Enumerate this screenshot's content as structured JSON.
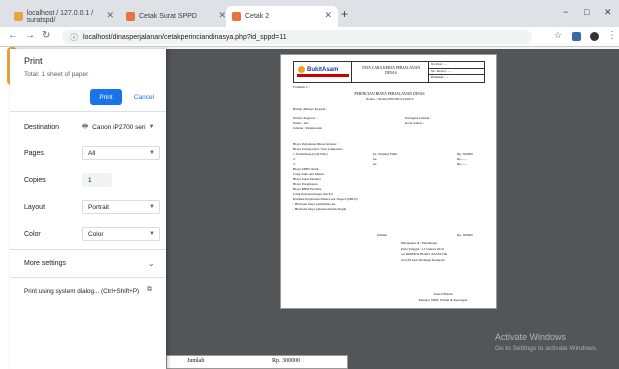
{
  "tabs": [
    {
      "title": "localhost / 127.0.0.1 / suratspd/"
    },
    {
      "title": "Cetak Surat SPPD"
    },
    {
      "title": "Cetak 2"
    }
  ],
  "new_tab": "+",
  "window_controls": [
    "−",
    "□",
    "✕"
  ],
  "url": "localhost/dinasperjalanan/cetakperinciandinasya.php?id_sppd=11",
  "print": {
    "title": "Print",
    "total": "Total: 1 sheet of paper",
    "print_button": "Print",
    "cancel_button": "Cancel",
    "destination_label": "Destination",
    "destination_value": "Canon iP2700 seri",
    "pages_label": "Pages",
    "pages_value": "All",
    "copies_label": "Copies",
    "copies_value": "1",
    "layout_label": "Layout",
    "layout_value": "Portrait",
    "color_label": "Color",
    "color_value": "Color",
    "more_settings": "More settings",
    "system_dialog": "Print using system dialog... (Ctrl+Shift+P)"
  },
  "doc": {
    "logo": "BukitAsam",
    "header": "TATA CARA KERJA PERJALANAN DINAS",
    "box": [
      "No.Dok : ...",
      "No. Revisi : ...",
      "Halaman : ..."
    ],
    "formulir": "Formulir 2 :",
    "title1": "PERINCIAN BIAYA PERJALANAN DINAS",
    "title2": "Nomor : 02/sm/2050/XII-013/2019",
    "greeting": "Hanup ditlunya Kepada :",
    "left": [
      "Nomor Pegawai :",
      "Nama : ilev",
      "Jabatan : Pengawasik"
    ],
    "right": [
      "Perlegkas Jabatan :",
      "Kode Satkas :"
    ],
    "body": [
      "Biaya Perjalanan Dinas Sebesar :",
      "Biaya Transportasi / Non Lumpsum :",
      "1. Palembang (Unit Dari)",
      "2.",
      "3.",
      "Biaya SPPD untuk",
      "Uang Saku dan Makan",
      "Biaya Taksi Pandara",
      "Biaya Penginapan",
      "Biaya BBM Pertalite",
      "Uang Penyeberangan dan Tol",
      "Klaimsn Perjalanan Dinas Luar Negeri (PDLN)",
      "- Biaviaan biaya pemberhas jas",
      "- Biaviaan biaya pakaian musim dingin"
    ],
    "mid": [
      "ke. Tanjung Enim",
      "ke.",
      "ke."
    ],
    "amounts": [
      "Rp. 300000",
      "Rp.......",
      "Rp......."
    ],
    "jumlah": "Jumlah",
    "jumlah_amt": "Rp. 300000",
    "sign": [
      "Ditetapkan di : Palembang",
      "Pada Tanggal : 13 Januari 2019",
      "a.n DIREKSI BUKIT ASAM Tbk",
      "ttu GM Unit Dermaga Kertapati"
    ],
    "sign2": [
      "Zaenal Halam",
      "Manajer SDM, Umum & Keuangan"
    ]
  },
  "under": {
    "left": "Jumlah",
    "right": "Rp. 300000"
  },
  "watermark": {
    "line1": "Activate Windows",
    "line2": "Go to Settings to activate Windows."
  }
}
